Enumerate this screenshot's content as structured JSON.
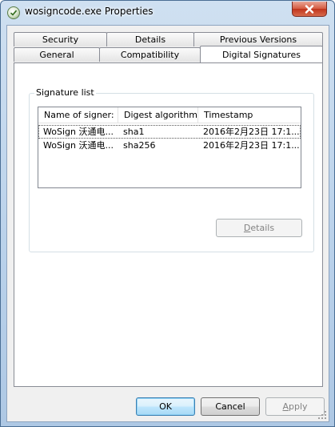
{
  "window": {
    "title": "wosigncode.exe Properties"
  },
  "tabs": {
    "row1": [
      {
        "label": "Security"
      },
      {
        "label": "Details"
      },
      {
        "label": "Previous Versions"
      }
    ],
    "row2": [
      {
        "label": "General"
      },
      {
        "label": "Compatibility"
      },
      {
        "label": "Digital Signatures"
      }
    ],
    "active": "Digital Signatures"
  },
  "signature_list": {
    "group_label": "Signature list",
    "columns": [
      "Name of signer:",
      "Digest algorithm",
      "Timestamp"
    ],
    "rows": [
      {
        "signer": "WoSign 沃通电...",
        "digest": "sha1",
        "timestamp": "2016年2月23日  17:1..."
      },
      {
        "signer": "WoSign 沃通电...",
        "digest": "sha256",
        "timestamp": "2016年2月23日  17:1..."
      }
    ],
    "details_button": {
      "label_u": "D",
      "label_rest": "etails"
    }
  },
  "buttons": {
    "ok": "OK",
    "cancel": "Cancel",
    "apply_u": "A",
    "apply_rest": "pply"
  },
  "colors": {
    "titlebar": "#b9d1ea",
    "close_button": "#c8442c",
    "dialog_background": "#f0f0f0"
  }
}
